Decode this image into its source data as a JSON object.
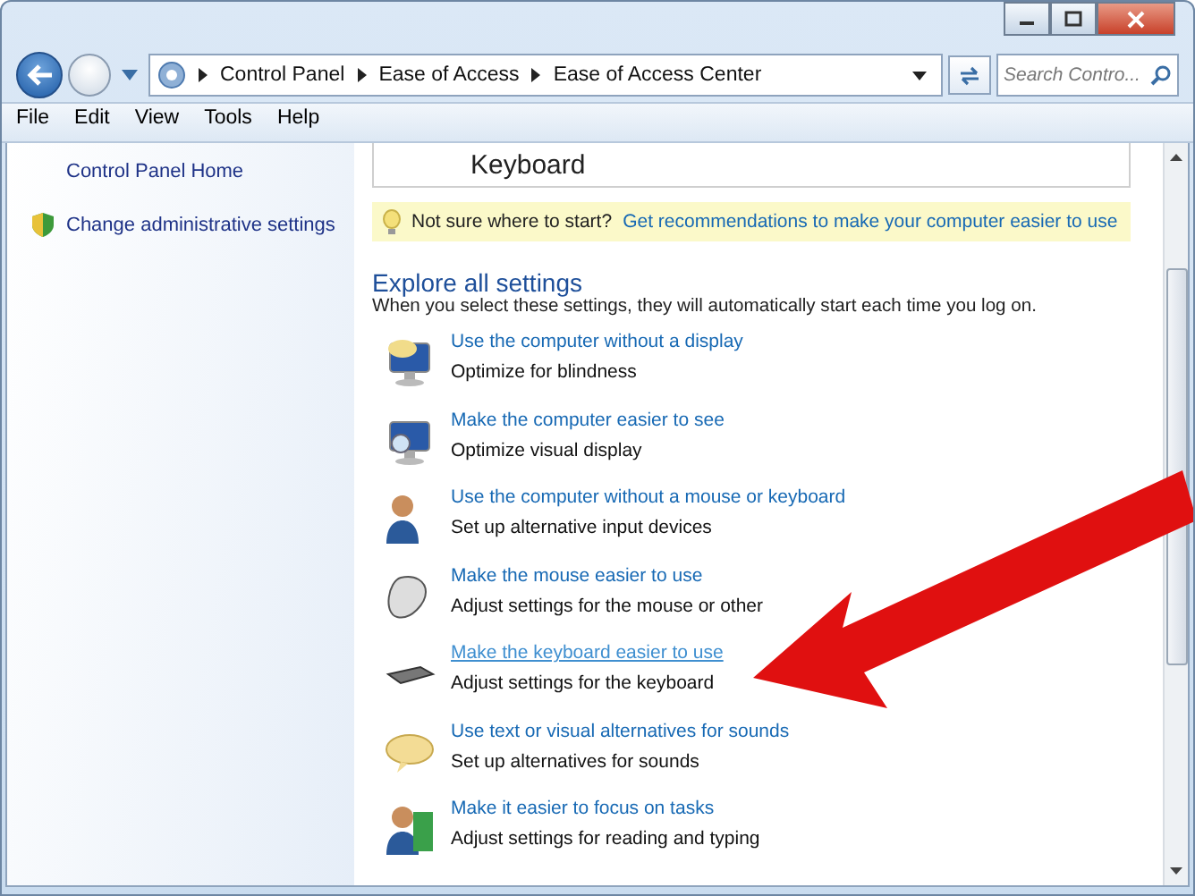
{
  "breadcrumb": [
    "Control Panel",
    "Ease of Access",
    "Ease of Access Center"
  ],
  "search": {
    "placeholder": "Search Contro..."
  },
  "menu": [
    "File",
    "Edit",
    "View",
    "Tools",
    "Help"
  ],
  "sidebar": {
    "items": [
      {
        "label": "Control Panel Home",
        "shield": false
      },
      {
        "label": "Change administrative settings",
        "shield": true
      }
    ]
  },
  "top_card": {
    "title": "Keyboard"
  },
  "tip": {
    "text": "Not sure where to start?",
    "link": "Get recommendations to make your computer easier to use"
  },
  "section": {
    "title": "Explore all settings",
    "subtitle": "When you select these settings, they will automatically start each time you log on."
  },
  "settings": [
    {
      "link": "Use the computer without a display",
      "description": "Optimize for blindness",
      "hovered": false
    },
    {
      "link": "Make the computer easier to see",
      "description": "Optimize visual display",
      "hovered": false
    },
    {
      "link": "Use the computer without a mouse or keyboard",
      "description": "Set up alternative input devices",
      "hovered": false
    },
    {
      "link": "Make the mouse easier to use",
      "description": "Adjust settings for the mouse or other",
      "hovered": false
    },
    {
      "link": "Make the keyboard easier to use",
      "description": "Adjust settings for the keyboard",
      "hovered": true
    },
    {
      "link": "Use text or visual alternatives for sounds",
      "description": "Set up alternatives for sounds",
      "hovered": false
    },
    {
      "link": "Make it easier to focus on tasks",
      "description": "Adjust settings for reading and typing",
      "hovered": false
    }
  ]
}
